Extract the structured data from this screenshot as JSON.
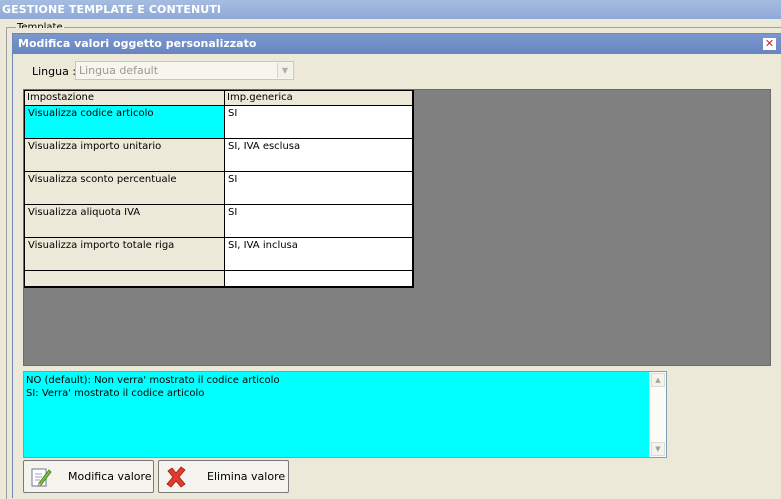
{
  "background": {
    "title": "GESTIONE TEMPLATE E CONTENUTI",
    "groupbox_label": "Template"
  },
  "dialog": {
    "title": "Modifica valori oggetto personalizzato",
    "close_glyph": "✕",
    "lingua": {
      "label": "Lingua :",
      "selected": "Lingua default"
    },
    "grid": {
      "columns": [
        "Impostazione",
        "Imp.generica"
      ],
      "rows": [
        {
          "impostazione": "Visualizza codice articolo",
          "valore": "SI"
        },
        {
          "impostazione": "Visualizza importo unitario",
          "valore": "SI, IVA esclusa"
        },
        {
          "impostazione": "Visualizza sconto percentuale",
          "valore": "SI"
        },
        {
          "impostazione": "Visualizza aliquota IVA",
          "valore": "SI"
        },
        {
          "impostazione": "Visualizza importo totale riga",
          "valore": "SI, IVA inclusa"
        }
      ]
    },
    "description": {
      "line1": "NO (default): Non verra' mostrato il codice articolo",
      "line2": "SI: Verra' mostrato il codice articolo"
    },
    "buttons": {
      "modifica": "Modifica valore",
      "elimina": "Elimina valore"
    }
  },
  "colors": {
    "selection": "#00ffff",
    "grid_background": "#808080",
    "window_face": "#ece9d8"
  }
}
